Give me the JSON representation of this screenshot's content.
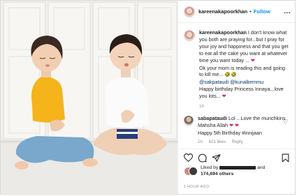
{
  "post": {
    "username": "kareenakapoorkhan",
    "dot": "•",
    "follow_label": "Follow",
    "more_label": "...",
    "caption": {
      "username": "kareenakapoorkhan",
      "line_1": "I don't know what you both are praying for...but I pray for your joy and happiness and that you get to eat all the cake you want at whatever time you want today ...",
      "line_2": "Ok your mom is reading this and going to kill me...",
      "mention_1": "@sakpataudi",
      "mention_2": "@kunalkemmu",
      "line_3": "Happy birthday Princess Innaya...love you lots...",
      "time_ago": "1h"
    },
    "comment": {
      "username": "sabapataudi",
      "text": "Lol ...Love the munchkins Mahsha Allah",
      "text_2": "Happy 5th Birthday #innijaan",
      "time_ago": "1h",
      "likes": "621 likes",
      "reply_label": "Reply"
    },
    "likes": {
      "prefix": "Liked by",
      "suffix": "and",
      "count": "174,694 others"
    },
    "timestamp": "1 HOUR AGO"
  },
  "icons": {
    "heart": "heart-icon",
    "comment": "comment-icon",
    "share": "share-icon",
    "save": "bookmark-icon"
  },
  "colors": {
    "link": "#0095f6",
    "heart": "#e0245e",
    "muted": "#8e8e8e"
  }
}
